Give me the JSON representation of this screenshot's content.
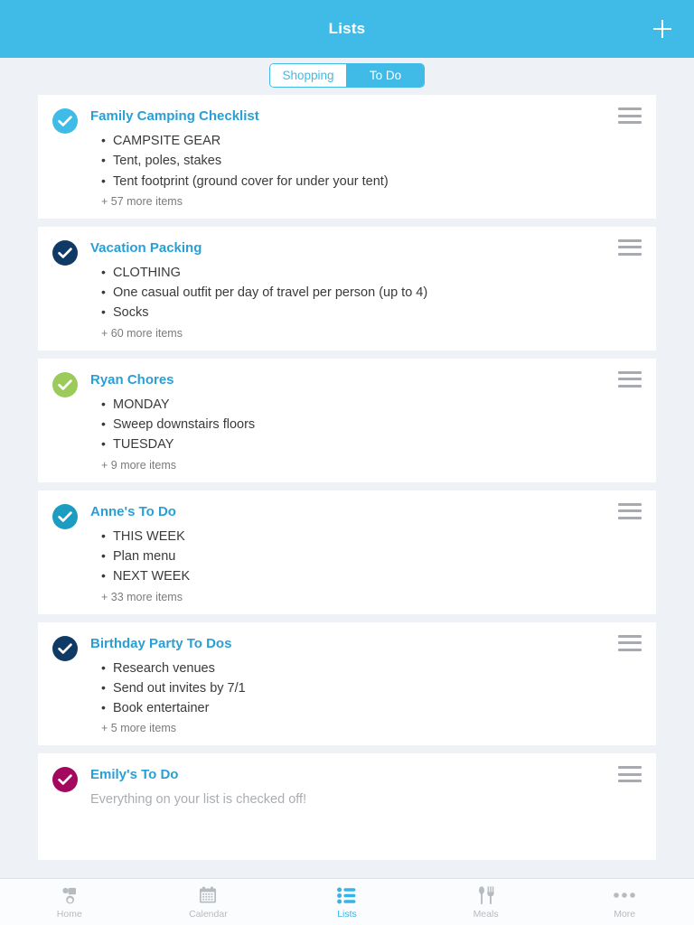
{
  "header": {
    "title": "Lists",
    "add_icon": "plus-icon",
    "background": "#40bbe8"
  },
  "segmented": {
    "options": [
      {
        "label": "Shopping",
        "active": false
      },
      {
        "label": "To Do",
        "active": true
      }
    ]
  },
  "lists": [
    {
      "title": "Family Camping Checklist",
      "check_color": "#3fbbe8",
      "items": [
        "CAMPSITE GEAR",
        "Tent, poles, stakes",
        "Tent footprint (ground cover for under your tent)"
      ],
      "more": "+ 57 more items",
      "empty_text": ""
    },
    {
      "title": "Vacation Packing",
      "check_color": "#103a66",
      "items": [
        "CLOTHING",
        " One casual outfit per day of travel per person (up to 4)",
        " Socks"
      ],
      "more": "+ 60 more items",
      "empty_text": ""
    },
    {
      "title": "Ryan Chores",
      "check_color": "#9ccb5b",
      "items": [
        "MONDAY",
        "Sweep downstairs floors",
        "TUESDAY"
      ],
      "more": "+ 9 more items",
      "empty_text": ""
    },
    {
      "title": "Anne's To Do",
      "check_color": "#1c9cc0",
      "items": [
        "THIS WEEK",
        "Plan menu",
        "NEXT WEEK"
      ],
      "more": "+ 33 more items",
      "empty_text": ""
    },
    {
      "title": "Birthday Party To Dos",
      "check_color": "#103a66",
      "items": [
        "Research venues",
        "Send out invites by 7/1",
        "Book entertainer"
      ],
      "more": "+ 5 more items",
      "empty_text": ""
    },
    {
      "title": "Emily's To Do",
      "check_color": "#a4075e",
      "items": [],
      "more": "",
      "empty_text": "Everything on your list is checked off!"
    }
  ],
  "tabs": [
    {
      "label": "Home",
      "icon": "family-icon",
      "active": false
    },
    {
      "label": "Calendar",
      "icon": "calendar-icon",
      "active": false
    },
    {
      "label": "Lists",
      "icon": "bulleted-list-icon",
      "active": true
    },
    {
      "label": "Meals",
      "icon": "spoon-fork-icon",
      "active": false
    },
    {
      "label": "More",
      "icon": "ellipsis-icon",
      "active": false
    }
  ],
  "colors": {
    "accent": "#40bbe8",
    "active_tab": "#36b4e5",
    "background": "#eef2f6",
    "card": "#ffffff"
  }
}
